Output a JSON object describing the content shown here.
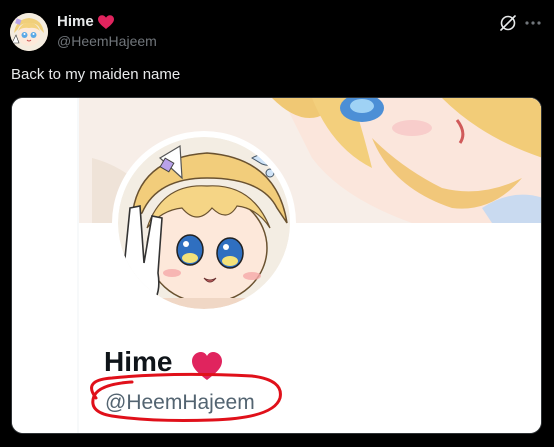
{
  "post": {
    "author": {
      "name": "Hime",
      "handle": "@HeemHajeem",
      "avatar_icon": "anime-avatar-icon",
      "badge_icon": "red-heart-icon"
    },
    "text": "Back to my maiden name",
    "actions": {
      "grok_icon": "grok-icon",
      "more_icon": "more-dots-icon"
    },
    "media": {
      "profile_name": "Hime",
      "profile_handle": "@HeemHajeem",
      "badge_icon": "red-heart-icon",
      "annotation": "red-circle-scribble"
    }
  },
  "colors": {
    "background": "#000000",
    "text_primary": "#e7e9ea",
    "text_secondary": "#71767b",
    "heart": "#e0245e",
    "annotation": "#e0101a"
  }
}
